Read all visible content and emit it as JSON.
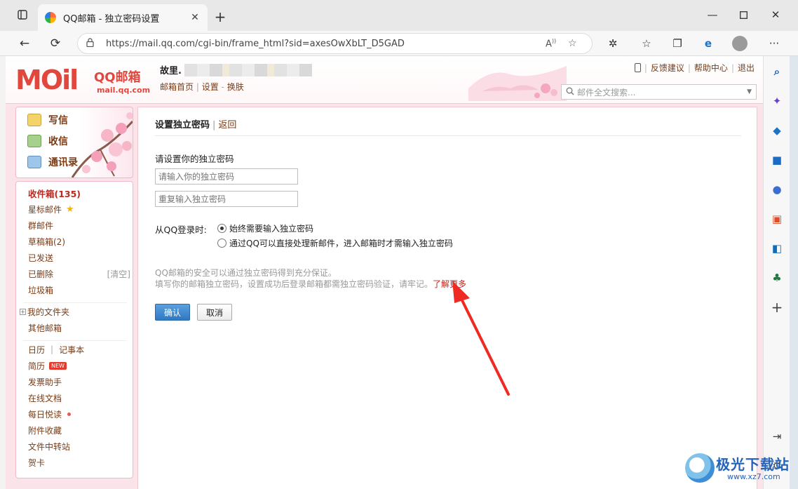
{
  "browser": {
    "tab_title": "QQ邮箱 - 独立密码设置",
    "url": "https://mail.qq.com/cgi-bin/frame_html?sid=axesOwXbLT_D5GAD"
  },
  "header": {
    "logo_big": "MOil",
    "logo_qq": "QQ邮箱",
    "logo_domain": "mail.qq.com",
    "user_name": "故里.",
    "user_links": [
      "邮箱首页",
      "设置",
      "换肤"
    ],
    "top_links": [
      "反馈建议",
      "帮助中心",
      "退出"
    ],
    "search_placeholder": "邮件全文搜索..."
  },
  "quick_actions": [
    "写信",
    "收信",
    "通讯录"
  ],
  "folders": {
    "inbox": "收件箱(135)",
    "starred": "星标邮件",
    "group": "群邮件",
    "drafts": "草稿箱(2)",
    "sent": "已发送",
    "deleted": "已删除",
    "clear": "[清空]",
    "trash": "垃圾箱",
    "my_folders": "我的文件夹",
    "other_mail": "其他邮箱",
    "calendar": "日历",
    "notebook": "记事本",
    "resume": "简历",
    "resume_badge": "NEW",
    "invoice": "发票助手",
    "docs": "在线文档",
    "daily": "每日悦读",
    "attachments": "附件收藏",
    "transfer": "文件中转站",
    "cards": "贺卡"
  },
  "content": {
    "title": "设置独立密码",
    "back": "返回",
    "set_label": "请设置你的独立密码",
    "pwd_placeholder": "请输入你的独立密码",
    "pwd_confirm_placeholder": "重复输入独立密码",
    "login_label": "从QQ登录时:",
    "option1": "始终需要输入独立密码",
    "option2": "通过QQ可以直接处理新邮件，进入邮箱时才需输入独立密码",
    "note1": "QQ邮箱的安全可以通过独立密码得到充分保证。",
    "note2": "填写你的邮箱独立密码，设置成功后登录邮箱都需独立密码验证，请牢记。",
    "learn_more": "了解更多",
    "ok": "确认",
    "cancel": "取消"
  },
  "watermark": {
    "title": "极光下载站",
    "url": "www.xz7.com"
  },
  "colors": {
    "brand_red": "#e1473c",
    "link_brown": "#7a3b15",
    "accent_pink": "#fbe3ea",
    "button_blue": "#2f79c3",
    "annotation_arrow": "#ee2a22"
  }
}
